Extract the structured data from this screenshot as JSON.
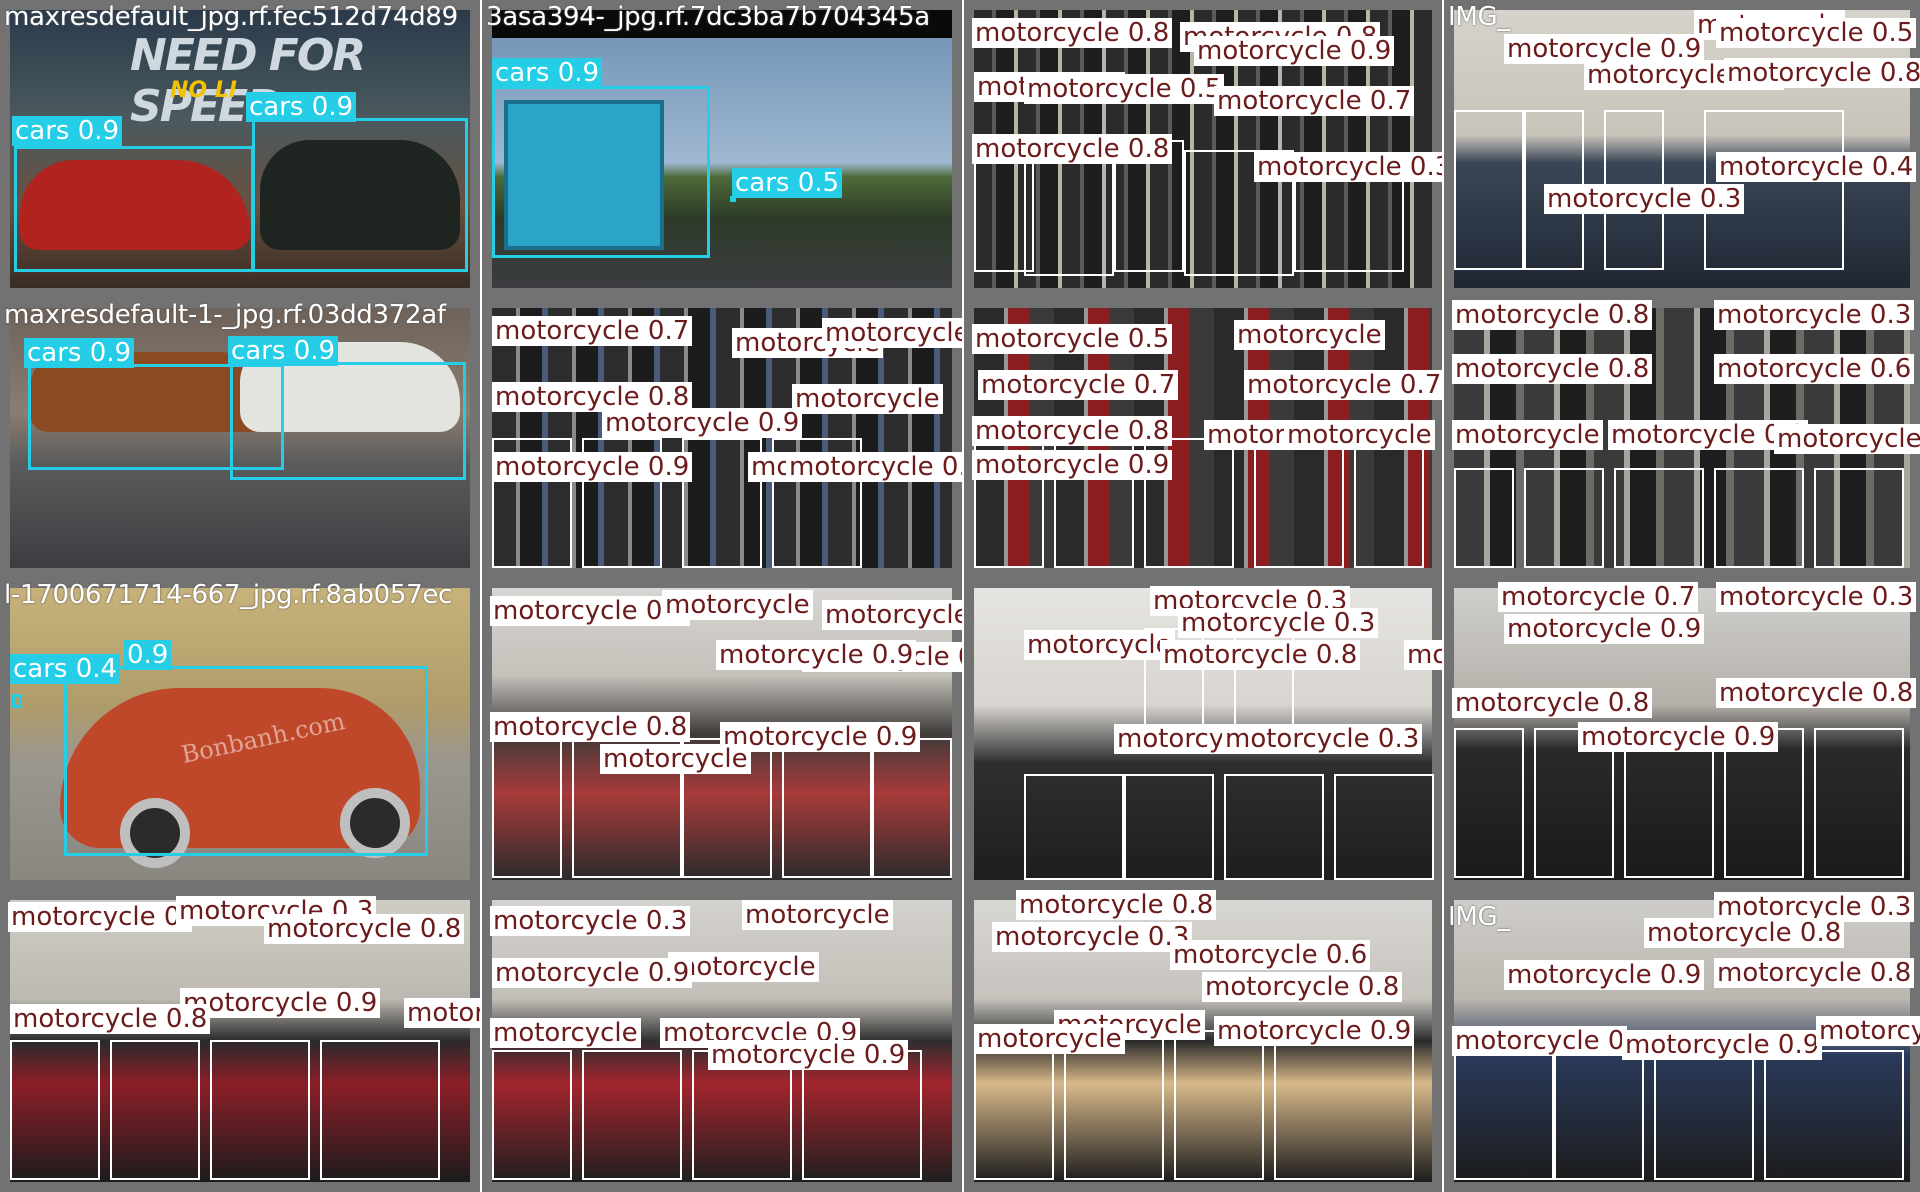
{
  "mosaic": {
    "columns": 4,
    "rows": 4,
    "background": "#727272",
    "box_colors": {
      "cars": "#25cde6",
      "motorcycle": "#ffffff"
    },
    "label_text_colors": {
      "cars": "#ffffff",
      "motorcycle": "#6b1b1b"
    }
  },
  "tiles": [
    {
      "id": "r0c0",
      "caption": "maxresdefault_jpg.rf.fec512d74d89",
      "scene_text": "NEED FOR SPEED",
      "scene_subtext": "NO LI",
      "labels": [
        "cars 0.9",
        "cars 0.9"
      ]
    },
    {
      "id": "r0c1",
      "caption": "3asa394-_jpg.rf.7dc3ba7b704345a",
      "labels": [
        "cars 0.9",
        "cars 0.5"
      ]
    },
    {
      "id": "r0c2",
      "labels": [
        "motorcycle 0.8",
        "motorcycle 0.8",
        "motorcycle",
        "motorcycle 0.5",
        "motorcycle 0.7",
        "motorcycle 0.8",
        "motorcycle 0.3",
        "motorcycle 0.9"
      ]
    },
    {
      "id": "r0c3",
      "caption": "IMG_",
      "labels": [
        "motorcycle",
        "motorcycle 0.5",
        "motorcycle 0.9",
        "motorcycle 0.9",
        "motorcycle 0.4",
        "motorcycle 0.3",
        "motorcycle 0.8"
      ]
    },
    {
      "id": "r1c0",
      "caption": "maxresdefault-1-_jpg.rf.03dd372af",
      "labels": [
        "cars 0.9",
        "cars 0.9"
      ]
    },
    {
      "id": "r1c1",
      "labels": [
        "motorcycle 0.7",
        "motorcycle",
        "motorcycle",
        "motorcycle 0.8",
        "motorcycle 0.9",
        "motorcycle",
        "motorcycle 0.9",
        "motorcycle",
        "motorcycle 0.8"
      ]
    },
    {
      "id": "r1c2",
      "labels": [
        "motorcycle 0.5",
        "motorcycle",
        "motorcycle 0.7",
        "motorcycle 0.7",
        "motorcycle 0.8",
        "motorcycle 0.9",
        "motorcycle",
        "motorcycle"
      ]
    },
    {
      "id": "r1c3",
      "labels": [
        "motorcycle 0.8",
        "motorcycle 0.3",
        "motorcycle 0.8",
        "motorcycle 0.6",
        "motorcycle",
        "motorcycle 0.8",
        "motorcycle 0.9"
      ]
    },
    {
      "id": "r2c0",
      "caption": "l-1700671714-667_jpg.rf.8ab057ec",
      "watermark": "Bonbanh.com",
      "labels": [
        "cars 0.4",
        "0.9"
      ]
    },
    {
      "id": "r2c1",
      "labels": [
        "motorcycle 0.4",
        "motorcycle",
        "motorcycle 0.5",
        "motorcycle 0.8",
        "motorcycle 0.9",
        "motorcycle 0.8",
        "motorcycle 0.9",
        "motorcycle"
      ]
    },
    {
      "id": "r2c2",
      "labels": [
        "motorcycle 0.3",
        "motorcycle 0.3",
        "motorcycle",
        "motorcycle 0.8",
        "motorcycle 0.5",
        "motorcycle 0.",
        "motorcycle 0.3"
      ]
    },
    {
      "id": "r2c3",
      "labels": [
        "motorcycle 0.7",
        "motorcycle 0.3",
        "motorcycle 0.8",
        "motorcycle 0.9",
        "motorcycle 0.8",
        "motorcycle 0.9"
      ]
    },
    {
      "id": "r3c0",
      "labels": [
        "motorcycle 0.",
        "motorcycle 0.3",
        "motorcycle 0.8",
        "motorcycle 0.9",
        "motorcycle 0.8",
        "motorcycle 0.8"
      ]
    },
    {
      "id": "r3c1",
      "labels": [
        "motorcycle 0.3",
        "motorcycle",
        "motorcycle",
        "motorcycle 0.9",
        "motorcycle",
        "motorcycle 0.9",
        "motorcycle 0.9"
      ]
    },
    {
      "id": "r3c2",
      "labels": [
        "motorcycle 0.8",
        "motorcycle 0.3",
        "motorcycle 0.6",
        "motorcycle 0.8",
        "motorcycle",
        "motorcycle 0.9",
        "motorcycle"
      ]
    },
    {
      "id": "r3c3",
      "caption": "IMG_",
      "labels": [
        "motorcycle 0.3",
        "motorcycle 0.8",
        "motorcycle 0.9",
        "motorcycle 0.8",
        "motorcycle 0",
        "motorcycle 0.9",
        "motorcycle 0.9"
      ]
    }
  ]
}
